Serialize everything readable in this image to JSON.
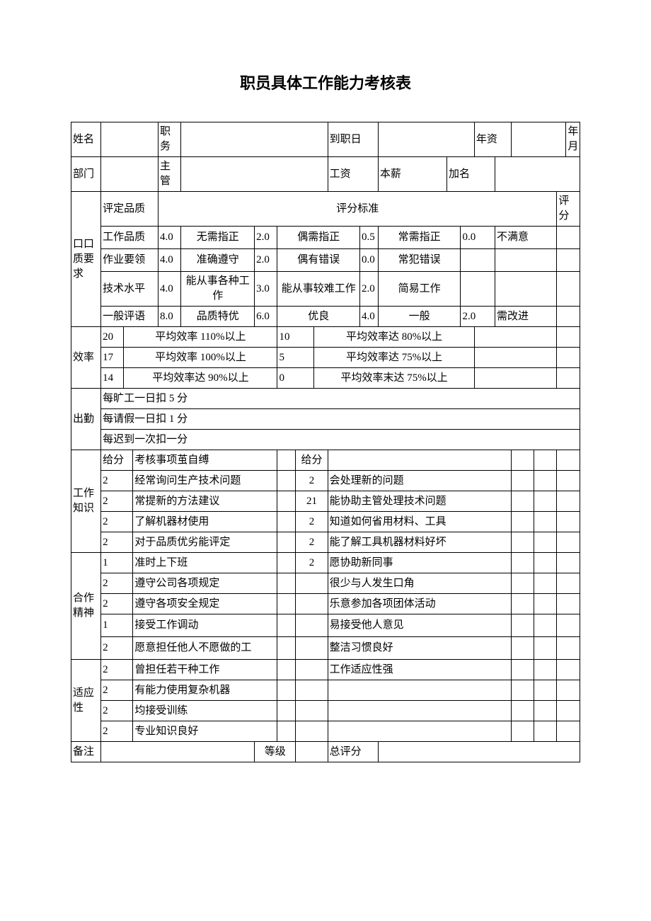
{
  "title": "职员具体工作能力考核表",
  "hdr": {
    "name": "姓名",
    "post": "职务",
    "hiredate": "到职日",
    "seniority": "年资",
    "ym": "年月",
    "dept": "部门",
    "mgr": "主管",
    "salary": "工资",
    "base": "本薪",
    "plus": "加名"
  },
  "qual": {
    "side": "口口质要求",
    "h1": "评定品质",
    "h2": "评分标准",
    "h3": "评分",
    "r1": {
      "a": "工作品质",
      "s1": "4.0",
      "t1": "无需指正",
      "s2": "2.0",
      "t2": "偶需指正",
      "s3": "0.5",
      "t3": "常需指正",
      "s4": "0.0",
      "t4": "不满意"
    },
    "r2": {
      "a": "作业要领",
      "s1": "4.0",
      "t1": "准确遵守",
      "s2": "2.0",
      "t2": "偶有错误",
      "s3": "0.0",
      "t3": "常犯错误"
    },
    "r3": {
      "a": "技术水平",
      "s1": "4.0",
      "t1": "能从事各种工作",
      "s2": "3.0",
      "t2": "能从事较难工作",
      "s3": "2.0",
      "t3": "简易工作"
    },
    "r4": {
      "a": "一般评语",
      "s1": "8.0",
      "t1": "品质特优",
      "s2": "6.0",
      "t2": "优良",
      "s3": "4.0",
      "t3": "一般",
      "s4": "2.0",
      "t4": "需改进"
    }
  },
  "eff": {
    "side": "效率",
    "r1": {
      "a": "20",
      "b": "平均效率 110%以上",
      "c": "10",
      "d": "平均效率达 80%以上"
    },
    "r2": {
      "a": "17",
      "b": "平均效率 100%以上",
      "c": "5",
      "d": "平均效率达 75%以上"
    },
    "r3": {
      "a": "14",
      "b": "平均效率达 90%以上",
      "c": "0",
      "d": "平均效率末达 75%以上"
    }
  },
  "att": {
    "side": "出勤",
    "r1": "每旷工一日扣 5 分",
    "r2": "每请假一日扣 1 分",
    "r3": "每迟到一次扣一分"
  },
  "know": {
    "side": "工作知识",
    "h1": "给分",
    "h2": "考核事项茧自缚",
    "h3": "给分",
    "r1": {
      "s": "2",
      "a": "经常询问生产技术问题",
      "s2": "2",
      "b": "会处理新的问题"
    },
    "r2": {
      "s": "2",
      "a": "常提新的方法建议",
      "s2": "21",
      "b": "能协助主管处理技术问题"
    },
    "r3": {
      "s": "2",
      "a": "了解机器材使用",
      "s2": "2",
      "b": "知道如何省用材料、工具"
    },
    "r4": {
      "s": "2",
      "a": "对于品质优劣能评定",
      "s2": "2",
      "b": "能了解工具机器材料好坏"
    }
  },
  "coop": {
    "side": "合作精神",
    "r1": {
      "s": "1",
      "a": "准时上下班",
      "s2": "2",
      "b": "愿协助新同事"
    },
    "r2": {
      "s": "2",
      "a": "遵守公司各项规定",
      "b": "很少与人发生口角"
    },
    "r3": {
      "s": "2",
      "a": "遵守各项安全规定",
      "b": "乐意参加各项团体活动"
    },
    "r4": {
      "s": "1",
      "a": "接受工作调动",
      "b": "易接受他人意见"
    },
    "r5": {
      "s": "2",
      "a": "愿意担任他人不愿做的工",
      "b": "整洁习惯良好"
    }
  },
  "adapt": {
    "side": "适应性",
    "r1": {
      "s": "2",
      "a": "曾担任若干种工作",
      "b": "工作适应性强"
    },
    "r2": {
      "s": "2",
      "a": "有能力使用复杂机器"
    },
    "r3": {
      "s": "2",
      "a": "均接受训练"
    },
    "r4": {
      "s": "2",
      "a": "专业知识良好"
    }
  },
  "foot": {
    "a": "备注",
    "b": "等级",
    "c": "总评分"
  }
}
